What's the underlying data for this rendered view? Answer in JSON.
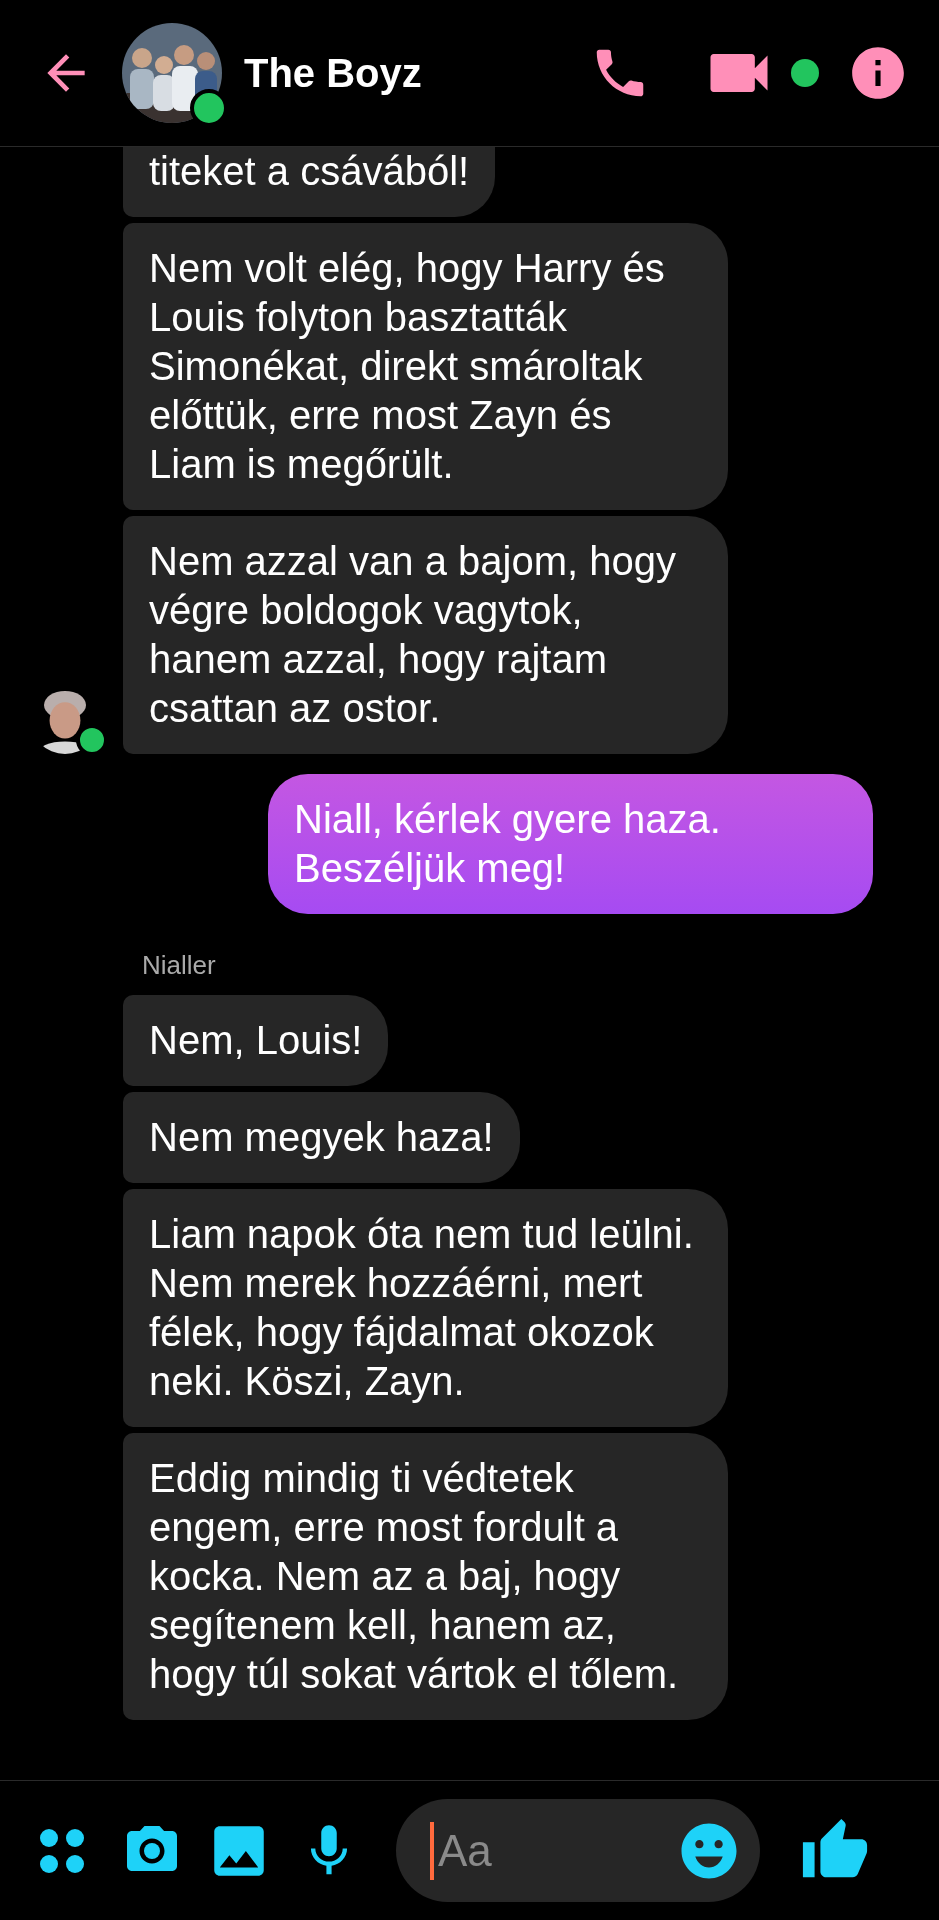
{
  "header": {
    "title": "The Boyz",
    "online": true,
    "video_active": true
  },
  "messages": [
    {
      "kind": "incoming",
      "text": "titeket a csávából!",
      "avatar": false
    },
    {
      "kind": "incoming",
      "text": "Nem volt elég, hogy Harry és Louis folyton basztatták Simonékat, direkt smároltak előttük, erre most Zayn és Liam is megőrült.",
      "avatar": false
    },
    {
      "kind": "incoming",
      "text": "Nem azzal van a bajom, hogy végre boldogok vagytok, hanem azzal, hogy rajtam csattan az ostor.",
      "avatar": true,
      "online": true
    },
    {
      "kind": "outgoing",
      "text": "Niall, kérlek gyere haza. Beszéljük meg!"
    },
    {
      "kind": "sender",
      "text": "Nialler"
    },
    {
      "kind": "incoming",
      "text": "Nem, Louis!",
      "avatar": false
    },
    {
      "kind": "incoming",
      "text": "Nem megyek haza!",
      "avatar": false
    },
    {
      "kind": "incoming",
      "text": "Liam napok óta nem tud leülni. Nem merek hozzáérni, mert félek, hogy fájdalmat okozok neki. Köszi, Zayn.",
      "avatar": false
    },
    {
      "kind": "incoming",
      "text": "Eddig mindig ti védtetek engem, erre most fordult a kocka. Nem az a baj, hogy segítenem kell, hanem az, hogy túl sokat vártok el tőlem.",
      "avatar": false
    }
  ],
  "composer": {
    "placeholder": "Aa"
  }
}
